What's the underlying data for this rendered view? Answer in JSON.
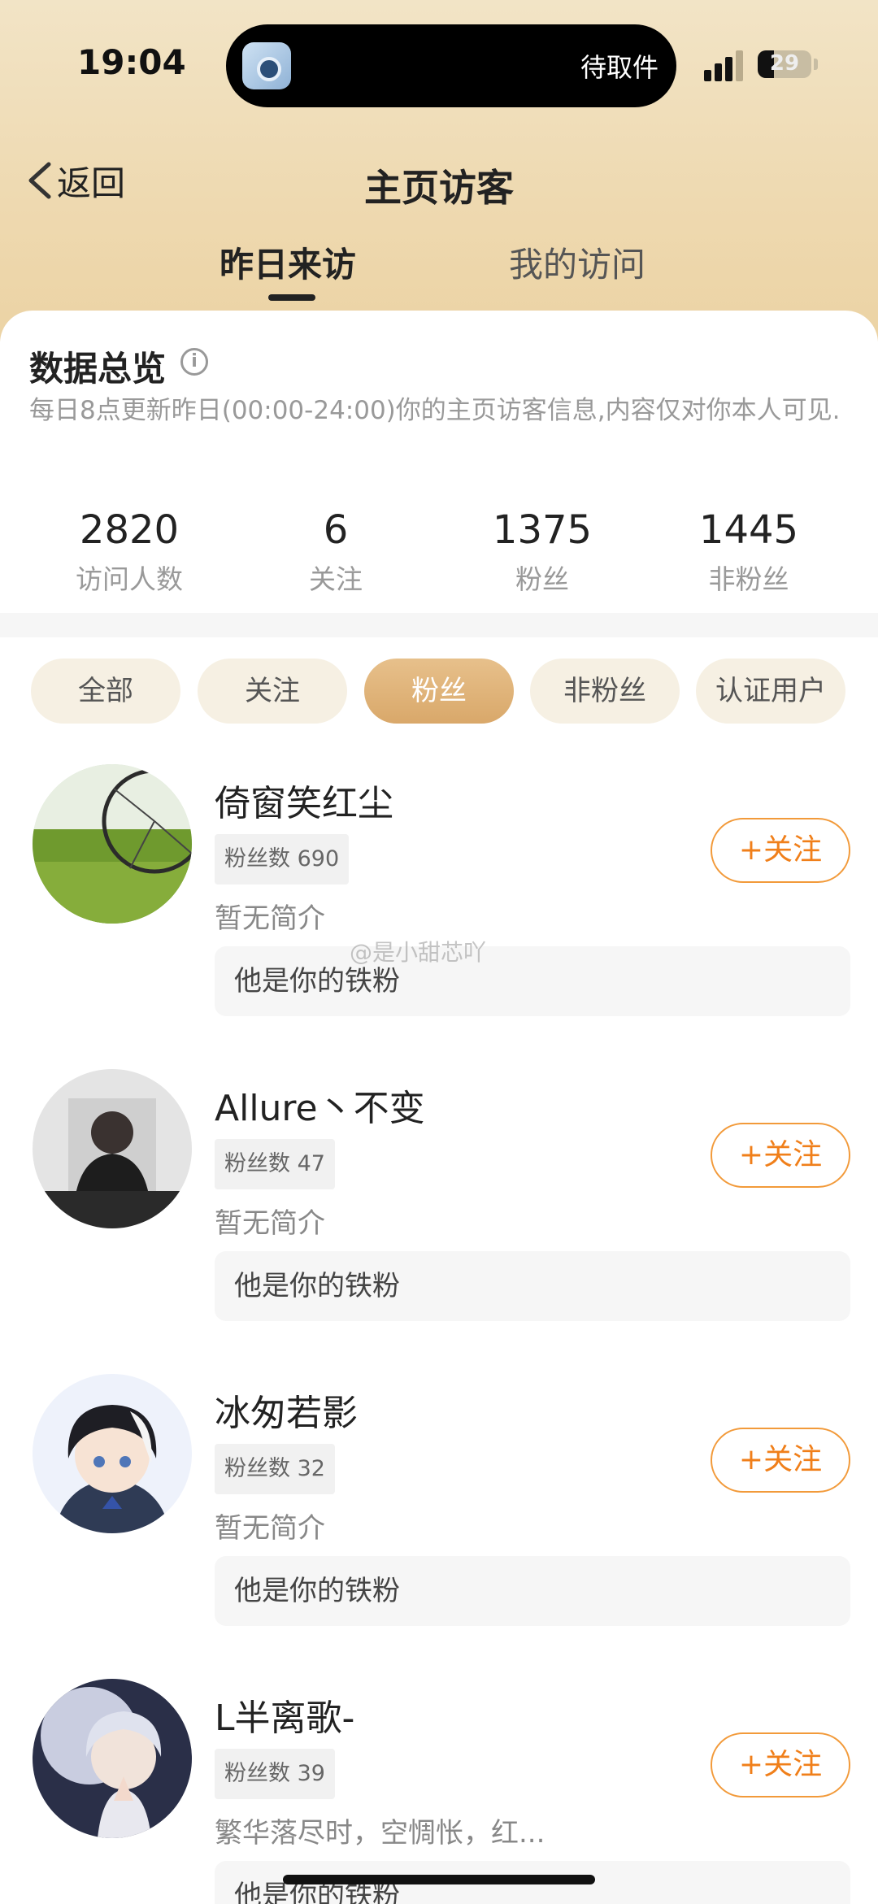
{
  "status_bar": {
    "time": "19:04",
    "island_text": "待取件",
    "battery": "29"
  },
  "nav": {
    "back_label": "返回",
    "title": "主页访客"
  },
  "tabs": [
    {
      "label": "昨日来访"
    },
    {
      "label": "我的访问"
    }
  ],
  "overview": {
    "title": "数据总览",
    "description": "每日8点更新昨日(00:00-24:00)你的主页访客信息,内容仅对你本人可见.",
    "stats": [
      {
        "value": "2820",
        "label": "访问人数"
      },
      {
        "value": "6",
        "label": "关注"
      },
      {
        "value": "1375",
        "label": "粉丝"
      },
      {
        "value": "1445",
        "label": "非粉丝"
      }
    ]
  },
  "filters": [
    {
      "label": "全部"
    },
    {
      "label": "关注"
    },
    {
      "label": "粉丝"
    },
    {
      "label": "非粉丝"
    },
    {
      "label": "认证用户"
    }
  ],
  "selected_filter": "粉丝",
  "colors": {
    "accent": "#f07f1a",
    "chip_active": "#dcac6e"
  },
  "visitors": [
    {
      "name": "倚窗笑红尘",
      "fans": "粉丝数 690",
      "bio": "暂无简介",
      "relation": "他是你的铁粉",
      "follow_label": "+关注",
      "avatar_icon": "bicycle-grass-avatar"
    },
    {
      "name": "Allure丶不变",
      "fans": "粉丝数 47",
      "bio": "暂无简介",
      "relation": "他是你的铁粉",
      "follow_label": "+关注",
      "avatar_icon": "man-back-avatar"
    },
    {
      "name": "冰匆若影",
      "fans": "粉丝数 32",
      "bio": "暂无简介",
      "relation": "他是你的铁粉",
      "follow_label": "+关注",
      "avatar_icon": "anime-boy-avatar"
    },
    {
      "name": "L半离歌-",
      "fans": "粉丝数 39",
      "bio": "繁华落尽时，空惆怅，红...",
      "relation": "他是你的铁粉",
      "follow_label": "+关注",
      "avatar_icon": "silver-hair-avatar"
    }
  ],
  "watermark": "@是小甜芯吖"
}
